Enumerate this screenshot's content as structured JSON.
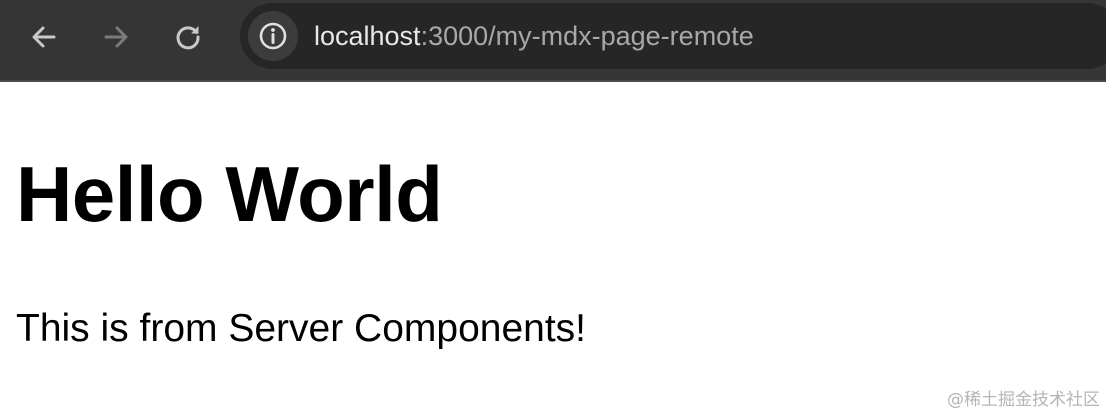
{
  "browser": {
    "url_host": "localhost",
    "url_path": ":3000/my-mdx-page-remote"
  },
  "page": {
    "heading": "Hello World",
    "paragraph": "This is from Server Components!"
  },
  "watermark": "@稀土掘金技术社区",
  "colors": {
    "toolbar_bg": "#353535",
    "omnibox_bg": "#262626",
    "page_bg": "#ffffff"
  }
}
